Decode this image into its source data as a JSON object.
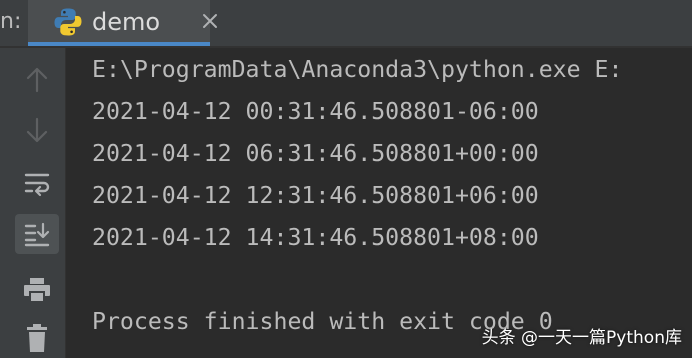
{
  "tabbar": {
    "run_label": "n:",
    "tab": {
      "title": "demo",
      "icon": "python-logo-icon",
      "close_icon": "close-icon"
    }
  },
  "sidebar": {
    "tools": [
      {
        "name": "scroll-up-icon",
        "active": false
      },
      {
        "name": "scroll-down-icon",
        "active": false
      },
      {
        "name": "soft-wrap-icon",
        "active": false
      },
      {
        "name": "scroll-to-end-icon",
        "active": true
      },
      {
        "name": "print-icon",
        "active": false
      },
      {
        "name": "trash-icon",
        "active": false
      }
    ]
  },
  "console": {
    "lines": [
      "E:\\ProgramData\\Anaconda3\\python.exe E:",
      "2021-04-12 00:31:46.508801-06:00",
      "2021-04-12 06:31:46.508801+00:00",
      "2021-04-12 12:31:46.508801+06:00",
      "2021-04-12 14:31:46.508801+08:00",
      "",
      "Process finished with exit code 0"
    ]
  },
  "watermark": "头条 @一天一篇Python库",
  "colors": {
    "editor_bg": "#2b2b2b",
    "panel_bg": "#3c3f41",
    "text": "#bbbbbb",
    "tab_underline": "#4a88c7",
    "icon": "#afb1b3"
  }
}
